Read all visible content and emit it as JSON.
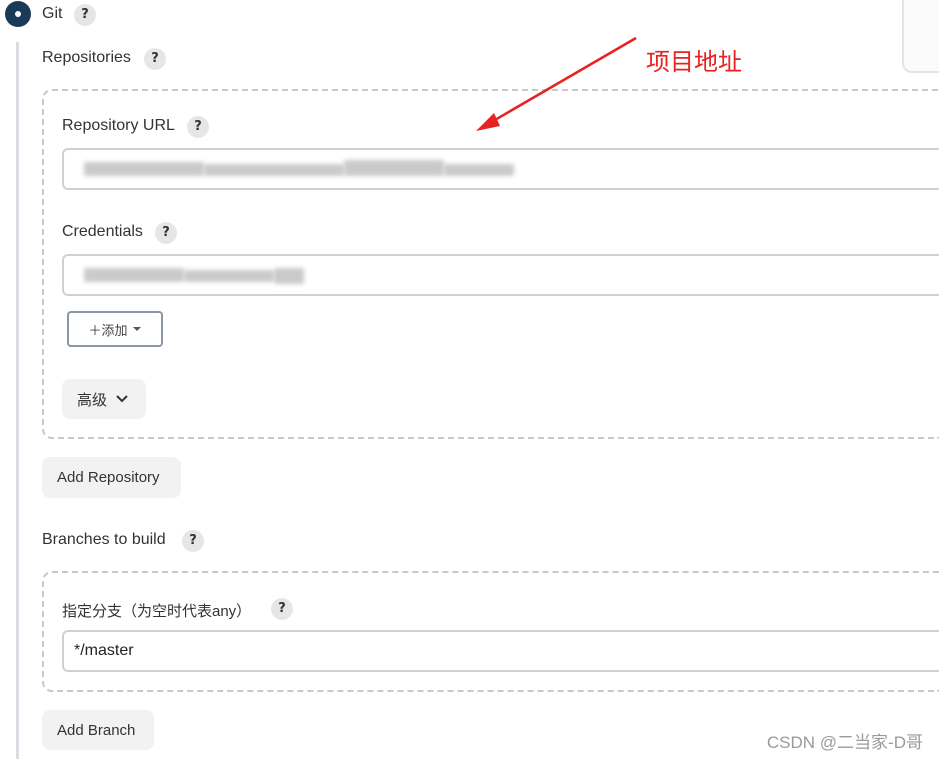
{
  "scm": {
    "git_label": "Git",
    "help_glyph": "?"
  },
  "repositories": {
    "label": "Repositories",
    "repository_url": {
      "label": "Repository URL",
      "value_redacted": true
    },
    "credentials": {
      "label": "Credentials",
      "add_button": "＋添加",
      "add_caret_icon": "caret-down-icon"
    },
    "advanced_button": "高级",
    "add_repository_button": "Add Repository"
  },
  "branches": {
    "label": "Branches to build",
    "branch_specifier_label": "指定分支（为空时代表any）",
    "branch_specifier_value": "*/master",
    "add_branch_button": "Add Branch"
  },
  "annotation": {
    "text": "项目地址",
    "color": "#e62222"
  },
  "watermark": "CSDN @二当家-D哥",
  "colors": {
    "radio": "#1a3a57",
    "field_border": "#ccd1d6",
    "dashed_border": "#c8c8c8"
  }
}
